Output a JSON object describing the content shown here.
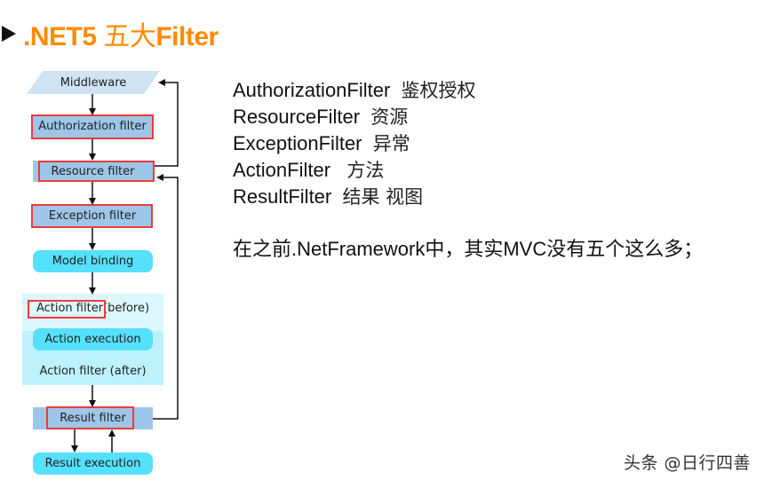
{
  "title": {
    "icon": "play-triangle-icon",
    "prefix": ".NET5 ",
    "cjk": "五大",
    "suffix": "Filter",
    "color": "#ff8a00"
  },
  "diagram": {
    "nodes": {
      "middleware": "Middleware",
      "authorization": "Authorization filter",
      "resource": "Resource filter",
      "exception": "Exception filter",
      "model_binding": "Model binding",
      "action_before_name": "Action filter",
      "action_before_suffix": " (before)",
      "action_execution": "Action execution",
      "action_after": "Action filter (after)",
      "result_filter": "Result filter",
      "result_execution": "Result execution"
    },
    "highlight_color": "#ee3b3b",
    "colors": {
      "middleware": "#cfe3f3",
      "filter_box": "#9dc6e8",
      "pill": "#55e0fb",
      "action_panel_top": "#dcf7fd",
      "action_panel_bottom": "#bdf2fc"
    }
  },
  "filters": [
    {
      "name": "AuthorizationFilter",
      "gap": "  ",
      "desc": "鉴权授权"
    },
    {
      "name": "ResourceFilter",
      "gap": "  ",
      "desc": "资源"
    },
    {
      "name": "ExceptionFilter",
      "gap": "  ",
      "desc": "异常"
    },
    {
      "name": "ActionFilter",
      "gap": "   ",
      "desc": "方法"
    },
    {
      "name": "ResultFilter",
      "gap": "  ",
      "desc": "结果 视图"
    }
  ],
  "note": "在之前.NetFramework中，其实MVC没有五个这么多；",
  "watermark": "头条 @日行四善"
}
